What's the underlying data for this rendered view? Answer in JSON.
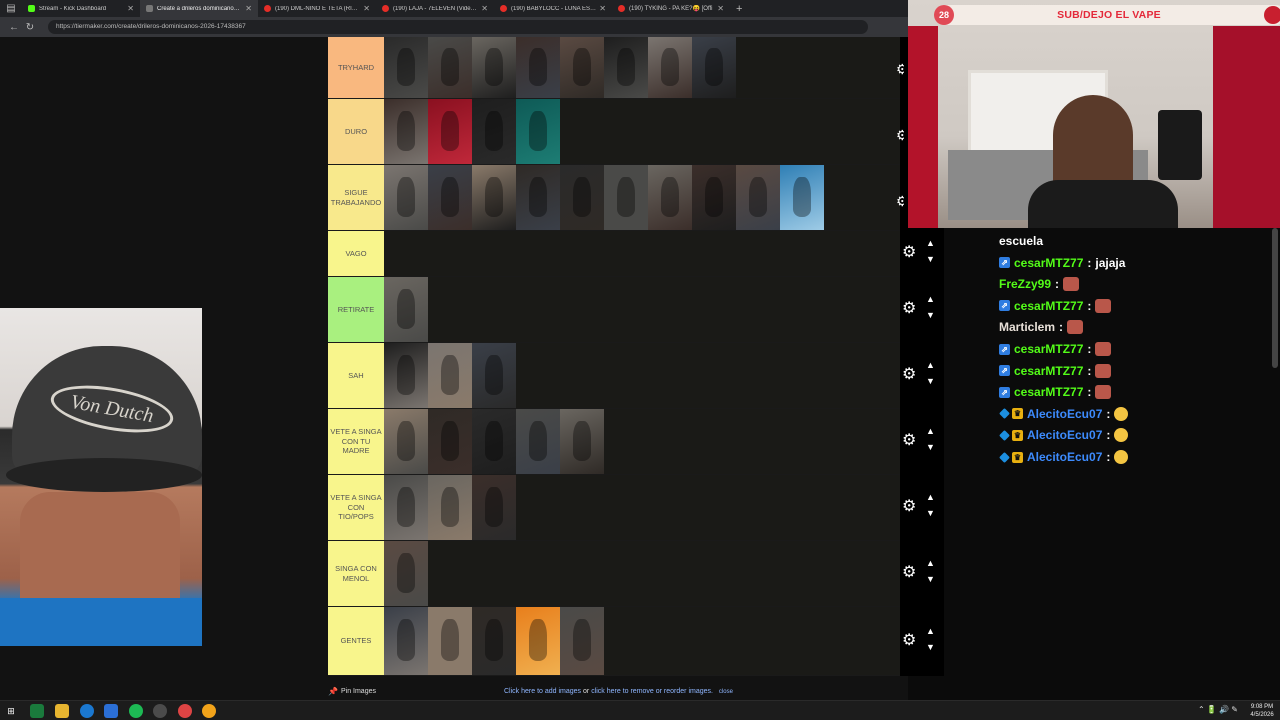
{
  "browser": {
    "tabs": [
      {
        "label": "Stream - Kick Dashboard",
        "favicon": "kick-icon",
        "active": false
      },
      {
        "label": "Create a drileros dominicanos 20",
        "favicon": "tiermaker-icon",
        "active": true
      },
      {
        "label": "(190) DML-NIÑO E TETA (RIP FLA",
        "favicon": "youtube-icon",
        "active": false
      },
      {
        "label": "(190) LAJA - 7ELEVEN (Video Ofic",
        "favicon": "youtube-icon",
        "active": false
      },
      {
        "label": "(190) BABYLOCC - LUNA ES LUNA",
        "favicon": "youtube-icon",
        "active": false
      },
      {
        "label": "(190) TYKING - PA KE?😝 [Offi",
        "favicon": "youtube-icon",
        "active": false
      }
    ],
    "url": "https://tiermaker.com/create/drileros-dominicanos-2026-17438367"
  },
  "tiers": [
    {
      "label": "TRYHARD",
      "color": "#f9b87f",
      "count": 8
    },
    {
      "label": "DURO",
      "color": "#f8d88a",
      "count": 4
    },
    {
      "label": "SIGUE TRABAJANDO",
      "color": "#f8e98c",
      "count": 10
    },
    {
      "label": "VAGO",
      "color": "#f8f58c",
      "count": 0
    },
    {
      "label": "RETIRATE",
      "color": "#a9f07f",
      "count": 1
    },
    {
      "label": "SAH",
      "color": "#f8f58c",
      "count": 3
    },
    {
      "label": "VETE A SINGA CON TU MADRE",
      "color": "#f8f58c",
      "count": 5
    },
    {
      "label": "VETE A SINGA CON TIO/POPS",
      "color": "#f8f58c",
      "count": 3
    },
    {
      "label": "SINGA CON MENOL",
      "color": "#f8f58c",
      "count": 1
    },
    {
      "label": "gentes",
      "color": "#f8f58c",
      "count": 5
    }
  ],
  "footer": {
    "pin_label": "Pin Images",
    "add_link": "Click here to add images",
    "or_text": "or",
    "remove_link": "click here to remove or reorder images.",
    "close_link": "close"
  },
  "webcam": {
    "cap_text": "Von Dutch"
  },
  "stream_overlay": {
    "sub_count": "28",
    "sub_goal": "SUB/DEJO EL VAPE"
  },
  "chat": [
    {
      "user": "",
      "text": "escuela",
      "color": "#ffffff",
      "badges": [],
      "emote": ""
    },
    {
      "user": "cesarMTZ77",
      "text": "jajaja",
      "color": "#53fc18",
      "badges": [
        "bot"
      ],
      "emote": ""
    },
    {
      "user": "FreZzy99",
      "text": "",
      "color": "#53fc18",
      "badges": [],
      "emote": "face"
    },
    {
      "user": "cesarMTZ77",
      "text": "",
      "color": "#53fc18",
      "badges": [
        "bot"
      ],
      "emote": "face"
    },
    {
      "user": "Marticlem",
      "text": "",
      "color": "#e8e0d8",
      "badges": [],
      "emote": "face"
    },
    {
      "user": "cesarMTZ77",
      "text": "",
      "color": "#53fc18",
      "badges": [
        "bot"
      ],
      "emote": "face"
    },
    {
      "user": "cesarMTZ77",
      "text": "",
      "color": "#53fc18",
      "badges": [
        "bot"
      ],
      "emote": "face"
    },
    {
      "user": "cesarMTZ77",
      "text": "",
      "color": "#53fc18",
      "badges": [
        "bot"
      ],
      "emote": "face"
    },
    {
      "user": "AlecitoEcu07",
      "text": "",
      "color": "#3d8bfd",
      "badges": [
        "gem",
        "crown"
      ],
      "emote": "laugh"
    },
    {
      "user": "AlecitoEcu07",
      "text": "",
      "color": "#3d8bfd",
      "badges": [
        "gem",
        "crown"
      ],
      "emote": "laugh"
    },
    {
      "user": "AlecitoEcu07",
      "text": "",
      "color": "#3d8bfd",
      "badges": [
        "gem",
        "crown"
      ],
      "emote": "laugh"
    }
  ],
  "taskbar": {
    "time": "9:08 PM",
    "date": "4/5/2026"
  }
}
